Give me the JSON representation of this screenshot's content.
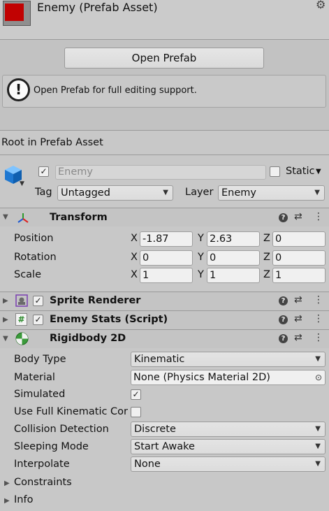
{
  "header": {
    "title": "Enemy (Prefab Asset)"
  },
  "open_prefab": {
    "button_label": "Open Prefab",
    "help_text": "Open Prefab for full editing support."
  },
  "root_label": "Root in Prefab Asset",
  "gameobject": {
    "active": true,
    "name": "Enemy",
    "static_label": "Static",
    "tag_label": "Tag",
    "tag_value": "Untagged",
    "layer_label": "Layer",
    "layer_value": "Enemy"
  },
  "transform": {
    "title": "Transform",
    "rows": [
      {
        "label": "Position",
        "x": "-1.87",
        "y": "2.63",
        "z": "0"
      },
      {
        "label": "Rotation",
        "x": "0",
        "y": "0",
        "z": "0"
      },
      {
        "label": "Scale",
        "x": "1",
        "y": "1",
        "z": "1"
      }
    ],
    "axes": [
      "X",
      "Y",
      "Z"
    ]
  },
  "sprite_renderer": {
    "title": "Sprite Renderer",
    "enabled": true
  },
  "enemy_stats": {
    "title": "Enemy Stats (Script)",
    "enabled": true
  },
  "rigidbody": {
    "title": "Rigidbody 2D",
    "body_type_label": "Body Type",
    "body_type_value": "Kinematic",
    "material_label": "Material",
    "material_value": "None (Physics Material 2D)",
    "simulated_label": "Simulated",
    "simulated": true,
    "full_kinematic_label": "Use Full Kinematic Cor",
    "full_kinematic": false,
    "collision_label": "Collision Detection",
    "collision_value": "Discrete",
    "sleeping_label": "Sleeping Mode",
    "sleeping_value": "Start Awake",
    "interpolate_label": "Interpolate",
    "interpolate_value": "None",
    "constraints_label": "Constraints",
    "info_label": "Info"
  },
  "colors": {
    "thumbnail": "#c10202",
    "panel": "#c8c8c8"
  },
  "icons": [
    "gear-icon",
    "info-icon",
    "cube-icon",
    "transform-icon",
    "sprite-renderer-icon",
    "script-icon",
    "rigidbody-icon",
    "help-icon",
    "preset-icon",
    "kebab-icon"
  ]
}
